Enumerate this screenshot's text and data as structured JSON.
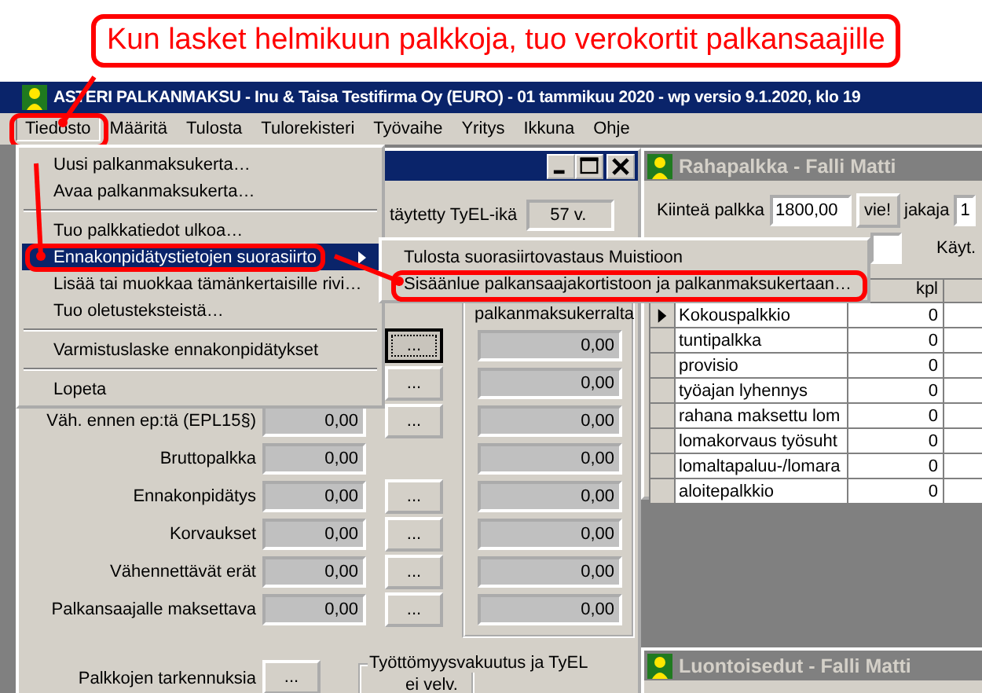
{
  "callout": {
    "text": "Kun lasket helmikuun palkkoja, tuo verokortit palkansaajille"
  },
  "window": {
    "title": "ASTERI PALKANMAKSU - Inu & Taisa Testifirma Oy (EURO) - 01 tammikuu 2020 - wp versio 9.1.2020, klo 19"
  },
  "menu_bar": [
    {
      "label": "Tiedosto",
      "selected": true,
      "annotated": true
    },
    {
      "label": "Määritä",
      "selected": false,
      "annotated": false
    },
    {
      "label": "Tulosta",
      "selected": false,
      "annotated": false
    },
    {
      "label": "Tulorekisteri",
      "selected": false,
      "annotated": false
    },
    {
      "label": "Työvaihe",
      "selected": false,
      "annotated": false
    },
    {
      "label": "Yritys",
      "selected": false,
      "annotated": false
    },
    {
      "label": "Ikkuna",
      "selected": false,
      "annotated": false
    },
    {
      "label": "Ohje",
      "selected": false,
      "annotated": false
    }
  ],
  "file_menu": [
    {
      "kind": "item",
      "label": "Uusi palkanmaksukerta…",
      "selected": false,
      "submenu": false,
      "annotated": false
    },
    {
      "kind": "item",
      "label": "Avaa palkanmaksukerta…",
      "selected": false,
      "submenu": false,
      "annotated": false
    },
    {
      "kind": "separator"
    },
    {
      "kind": "item",
      "label": "Tuo palkkatiedot ulkoa…",
      "selected": false,
      "submenu": false,
      "annotated": false
    },
    {
      "kind": "item",
      "label": "Ennakonpidätystietojen suorasiirto",
      "selected": true,
      "submenu": true,
      "annotated": true
    },
    {
      "kind": "item",
      "label": "Lisää tai muokkaa tämänkertaisille rivi…",
      "selected": false,
      "submenu": false,
      "annotated": false
    },
    {
      "kind": "item",
      "label": "Tuo oletusteksteistä…",
      "selected": false,
      "submenu": false,
      "annotated": false
    },
    {
      "kind": "separator"
    },
    {
      "kind": "item",
      "label": "Varmistuslaske ennakonpidätykset",
      "selected": false,
      "submenu": false,
      "annotated": false
    },
    {
      "kind": "separator"
    },
    {
      "kind": "item",
      "label": "Lopeta",
      "selected": false,
      "submenu": false,
      "annotated": false
    }
  ],
  "submenu": [
    {
      "label": "Tulosta suorasiirtovastaus Muistioon",
      "selected": false,
      "annotated": false
    },
    {
      "label": "Sisäänlue palkansaajakortistoon ja palkanmaksukertaan…",
      "selected": false,
      "annotated": true
    }
  ],
  "payroll_window": {
    "tyel_age_label": "täytetty TyEL-ikä",
    "tyel_age_value": "57 v.",
    "group_label": "palkanmaksukerralta",
    "rows": [
      {
        "button": "...",
        "focused": true
      },
      {
        "button": "...",
        "focused": false
      },
      {
        "label": "Väh. ennen ep:tä (EPL15§)",
        "value": "0,00",
        "button": "...",
        "focused": false
      },
      {
        "label": "Bruttopalkka",
        "value": "0,00"
      },
      {
        "label": "Ennakonpidätys",
        "value": "0,00",
        "button": "...",
        "focused": false
      },
      {
        "label": "Korvaukset",
        "value": "0,00",
        "button": "...",
        "focused": false
      },
      {
        "label": "Vähennettävät erät",
        "value": "0,00",
        "button": "...",
        "focused": false
      },
      {
        "label": "Palkansaajalle maksettava",
        "value": "0,00",
        "button": "...",
        "focused": false
      }
    ],
    "period_values": [
      "0,00",
      "0,00",
      "0,00",
      "0,00",
      "0,00",
      "0,00",
      "0,00",
      "0,00"
    ],
    "details_label": "Palkkojen tarkennuksia",
    "details_button": "...",
    "insurance_group": {
      "label": "Työttömyysvakuutus ja TyEL",
      "option": "ei velv."
    }
  },
  "salary_window": {
    "title": "Rahapalkka - Falli Matti",
    "fixed_label": "Kiinteä palkka",
    "fixed_value": "1800,00",
    "apply_button": "vie!",
    "divisor_label": "jakaja",
    "divisor_value": "1",
    "used_label": "Käyt.",
    "columns": [
      "kpl"
    ],
    "rows": [
      {
        "name": "Kokouspalkkio",
        "kpl": "0",
        "selected": true
      },
      {
        "name": "tuntipalkka",
        "kpl": "0",
        "selected": false
      },
      {
        "name": "provisio",
        "kpl": "0",
        "selected": false
      },
      {
        "name": "työajan lyhennys",
        "kpl": "0",
        "selected": false
      },
      {
        "name": "rahana maksettu lom",
        "kpl": "0",
        "selected": false
      },
      {
        "name": "lomakorvaus työsuht",
        "kpl": "0",
        "selected": false
      },
      {
        "name": "lomaltapaluu-/lomara",
        "kpl": "0",
        "selected": false
      },
      {
        "name": "aloitepalkkio",
        "kpl": "0",
        "selected": false
      }
    ]
  },
  "benefits_window": {
    "title": "Luontoisedut - Falli Matti"
  }
}
